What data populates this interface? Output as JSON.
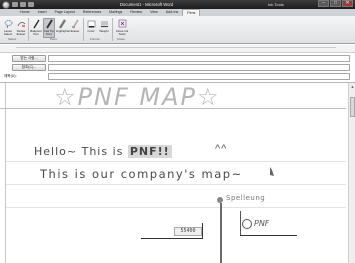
{
  "window": {
    "title": "Document1 - Microsoft Word",
    "context_title": "Ink Tools",
    "minimize": "–",
    "maximize": "□",
    "close": "✕"
  },
  "ribbon_tabs": [
    "Home",
    "Insert",
    "Page Layout",
    "References",
    "Mailings",
    "Review",
    "View",
    "Add-Ins",
    "Pens"
  ],
  "active_tab_index": 8,
  "ribbon_tools": [
    {
      "label": "Lasso Select",
      "icon": "lasso-icon"
    },
    {
      "label": "Stroke Eraser",
      "icon": "eraser-icon"
    },
    {
      "label": "Ballpoint Pen",
      "icon": "ballpoint-pen-icon"
    },
    {
      "label": "Felt Tip Pen",
      "icon": "felt-tip-pen-icon"
    },
    {
      "label": "Highlighter",
      "icon": "highlighter-icon"
    },
    {
      "label": "Eraser",
      "icon": "eraser-icon"
    },
    {
      "label": "Color",
      "icon": "color-icon"
    },
    {
      "label": "Weight",
      "icon": "weight-icon"
    },
    {
      "label": "Close Ink Tools",
      "icon": "close-ink-icon"
    }
  ],
  "ribbon_groups": [
    "Select",
    "Pens",
    "Format",
    "Close"
  ],
  "header_fields": [
    {
      "label": "",
      "button": "받는 사람..."
    },
    {
      "label": "",
      "button": "참조(C)..."
    },
    {
      "label": "제목(U):",
      "button": ""
    }
  ],
  "page": {
    "title": "☆PNF MAP☆",
    "line1_prefix": "Hello~ This is ",
    "line1_highlight": "PNF!!",
    "line1_emoticon": "^^",
    "line2": "This is our company's map~",
    "landmark_label": "Spelleung",
    "price_box": "55400",
    "logo_text": "PNF"
  },
  "colors": {
    "titlebar": "#2a2a2a",
    "ribbon": "#e6e8eb",
    "ink": "#4a4a4a",
    "highlight": "#d8d8d8"
  }
}
